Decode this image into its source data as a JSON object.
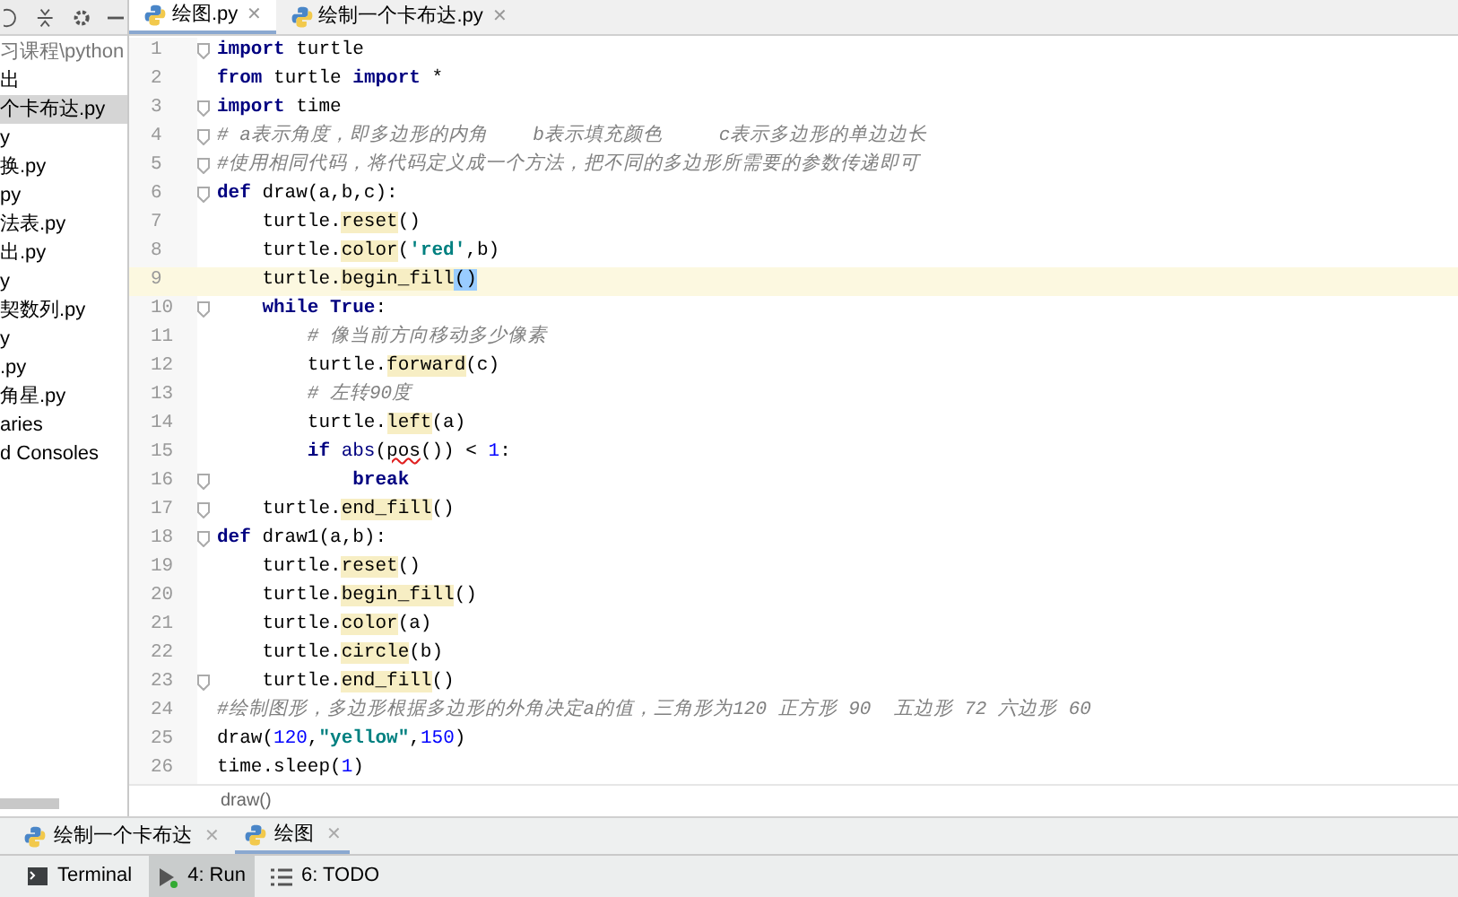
{
  "sidebar": {
    "items": [
      {
        "label": "习课程\\python",
        "selected": false
      },
      {
        "label": "出",
        "selected": false
      },
      {
        "label": "个卡布达.py",
        "selected": true
      },
      {
        "label": "y",
        "selected": false
      },
      {
        "label": "换.py",
        "selected": false
      },
      {
        "label": "py",
        "selected": false
      },
      {
        "label": "法表.py",
        "selected": false
      },
      {
        "label": "出.py",
        "selected": false
      },
      {
        "label": "y",
        "selected": false
      },
      {
        "label": "契数列.py",
        "selected": false
      },
      {
        "label": "y",
        "selected": false
      },
      {
        "label": ".py",
        "selected": false
      },
      {
        "label": "角星.py",
        "selected": false
      },
      {
        "label": "aries",
        "selected": false
      },
      {
        "label": "d Consoles",
        "selected": false
      }
    ]
  },
  "editor_tabs": [
    {
      "label": "绘图.py",
      "close": "✕",
      "selected": true
    },
    {
      "label": "绘制一个卡布达.py",
      "close": "✕",
      "selected": false
    }
  ],
  "code": [
    {
      "n": "1",
      "fold": true,
      "current": false,
      "tokens": [
        {
          "kind": "kw",
          "text": "import"
        },
        {
          "kind": "plain",
          "text": " turtle"
        }
      ]
    },
    {
      "n": "2",
      "fold": false,
      "current": false,
      "tokens": [
        {
          "kind": "kw",
          "text": "from"
        },
        {
          "kind": "plain",
          "text": " turtle "
        },
        {
          "kind": "kw",
          "text": "import"
        },
        {
          "kind": "plain",
          "text": " *"
        }
      ]
    },
    {
      "n": "3",
      "fold": true,
      "current": false,
      "tokens": [
        {
          "kind": "kw",
          "text": "import"
        },
        {
          "kind": "plain",
          "text": " time"
        }
      ]
    },
    {
      "n": "4",
      "fold": true,
      "current": false,
      "tokens": [
        {
          "kind": "comment",
          "text": "# a表示角度，即多边形的内角    b表示填充颜色     c表示多边形的单边边长"
        }
      ]
    },
    {
      "n": "5",
      "fold": true,
      "current": false,
      "tokens": [
        {
          "kind": "comment",
          "text": "#使用相同代码，将代码定义成一个方法，把不同的多边形所需要的参数传递即可"
        }
      ]
    },
    {
      "n": "6",
      "fold": true,
      "current": false,
      "tokens": [
        {
          "kind": "kw",
          "text": "def"
        },
        {
          "kind": "plain",
          "text": " draw(a,b,c):"
        }
      ]
    },
    {
      "n": "7",
      "fold": false,
      "current": false,
      "tokens": [
        {
          "kind": "plain",
          "text": "    turtle."
        },
        {
          "kind": "method",
          "text": "reset"
        },
        {
          "kind": "plain",
          "text": "()"
        }
      ]
    },
    {
      "n": "8",
      "fold": false,
      "current": false,
      "tokens": [
        {
          "kind": "plain",
          "text": "    turtle."
        },
        {
          "kind": "method",
          "text": "color"
        },
        {
          "kind": "plain",
          "text": "("
        },
        {
          "kind": "str",
          "text": "'red'"
        },
        {
          "kind": "plain",
          "text": ",b)"
        }
      ]
    },
    {
      "n": "9",
      "fold": false,
      "current": true,
      "tokens": [
        {
          "kind": "plain",
          "text": "    turtle."
        },
        {
          "kind": "method",
          "text": "begin_fill"
        },
        {
          "kind": "match",
          "text": "()"
        }
      ]
    },
    {
      "n": "10",
      "fold": true,
      "current": false,
      "tokens": [
        {
          "kind": "kw",
          "text": "    while True"
        },
        {
          "kind": "plain",
          "text": ":"
        }
      ]
    },
    {
      "n": "11",
      "fold": false,
      "current": false,
      "tokens": [
        {
          "kind": "comment",
          "text": "        # 像当前方向移动多少像素"
        }
      ]
    },
    {
      "n": "12",
      "fold": false,
      "current": false,
      "tokens": [
        {
          "kind": "plain",
          "text": "        turtle."
        },
        {
          "kind": "method",
          "text": "forward"
        },
        {
          "kind": "plain",
          "text": "(c)"
        }
      ]
    },
    {
      "n": "13",
      "fold": false,
      "current": false,
      "tokens": [
        {
          "kind": "comment",
          "text": "        # 左转90度"
        }
      ]
    },
    {
      "n": "14",
      "fold": false,
      "current": false,
      "tokens": [
        {
          "kind": "plain",
          "text": "        turtle."
        },
        {
          "kind": "method",
          "text": "left"
        },
        {
          "kind": "plain",
          "text": "(a)"
        }
      ]
    },
    {
      "n": "15",
      "fold": false,
      "current": false,
      "tokens": [
        {
          "kind": "kw",
          "text": "        if"
        },
        {
          "kind": "builtin",
          "text": " abs"
        },
        {
          "kind": "plain",
          "text": "("
        },
        {
          "kind": "warn",
          "text": "pos"
        },
        {
          "kind": "plain",
          "text": "()) < "
        },
        {
          "kind": "num",
          "text": "1"
        },
        {
          "kind": "plain",
          "text": ":"
        }
      ]
    },
    {
      "n": "16",
      "fold": true,
      "current": false,
      "tokens": [
        {
          "kind": "kw",
          "text": "            break"
        }
      ]
    },
    {
      "n": "17",
      "fold": true,
      "current": false,
      "tokens": [
        {
          "kind": "plain",
          "text": "    turtle."
        },
        {
          "kind": "method",
          "text": "end_fill"
        },
        {
          "kind": "plain",
          "text": "()"
        }
      ]
    },
    {
      "n": "18",
      "fold": true,
      "current": false,
      "tokens": [
        {
          "kind": "kw",
          "text": "def"
        },
        {
          "kind": "plain",
          "text": " draw1(a,b):"
        }
      ]
    },
    {
      "n": "19",
      "fold": false,
      "current": false,
      "tokens": [
        {
          "kind": "plain",
          "text": "    turtle."
        },
        {
          "kind": "method",
          "text": "reset"
        },
        {
          "kind": "plain",
          "text": "()"
        }
      ]
    },
    {
      "n": "20",
      "fold": false,
      "current": false,
      "tokens": [
        {
          "kind": "plain",
          "text": "    turtle."
        },
        {
          "kind": "method",
          "text": "begin_fill"
        },
        {
          "kind": "plain",
          "text": "()"
        }
      ]
    },
    {
      "n": "21",
      "fold": false,
      "current": false,
      "tokens": [
        {
          "kind": "plain",
          "text": "    turtle."
        },
        {
          "kind": "method",
          "text": "color"
        },
        {
          "kind": "plain",
          "text": "(a)"
        }
      ]
    },
    {
      "n": "22",
      "fold": false,
      "current": false,
      "tokens": [
        {
          "kind": "plain",
          "text": "    turtle."
        },
        {
          "kind": "method",
          "text": "circle"
        },
        {
          "kind": "plain",
          "text": "(b)"
        }
      ]
    },
    {
      "n": "23",
      "fold": true,
      "current": false,
      "tokens": [
        {
          "kind": "plain",
          "text": "    turtle."
        },
        {
          "kind": "method",
          "text": "end_fill"
        },
        {
          "kind": "plain",
          "text": "()"
        }
      ]
    },
    {
      "n": "24",
      "fold": false,
      "current": false,
      "tokens": [
        {
          "kind": "comment",
          "text": "#绘制图形，多边形根据多边形的外角决定a的值，三角形为120 正方形 90  五边形 72 六边形 60"
        }
      ]
    },
    {
      "n": "25",
      "fold": false,
      "current": false,
      "tokens": [
        {
          "kind": "plain",
          "text": "draw("
        },
        {
          "kind": "num",
          "text": "120"
        },
        {
          "kind": "plain",
          "text": ","
        },
        {
          "kind": "str",
          "text": "\"yellow\""
        },
        {
          "kind": "plain",
          "text": ","
        },
        {
          "kind": "num",
          "text": "150"
        },
        {
          "kind": "plain",
          "text": ")"
        }
      ]
    },
    {
      "n": "26",
      "fold": false,
      "current": false,
      "tokens": [
        {
          "kind": "plain",
          "text": "time.sleep("
        },
        {
          "kind": "num",
          "text": "1"
        },
        {
          "kind": "plain",
          "text": ")"
        }
      ]
    }
  ],
  "breadcrumb": "draw()",
  "run_tabs": [
    {
      "label": "绘制一个卡布达",
      "close": "✕",
      "selected": false
    },
    {
      "label": "绘图",
      "close": "✕",
      "selected": true
    }
  ],
  "tool_windows": [
    {
      "kind": "terminal",
      "label": "Terminal",
      "selected": false
    },
    {
      "kind": "run",
      "label": "4: Run",
      "selected": true
    },
    {
      "kind": "todo",
      "label": "6: TODO",
      "selected": false
    }
  ]
}
